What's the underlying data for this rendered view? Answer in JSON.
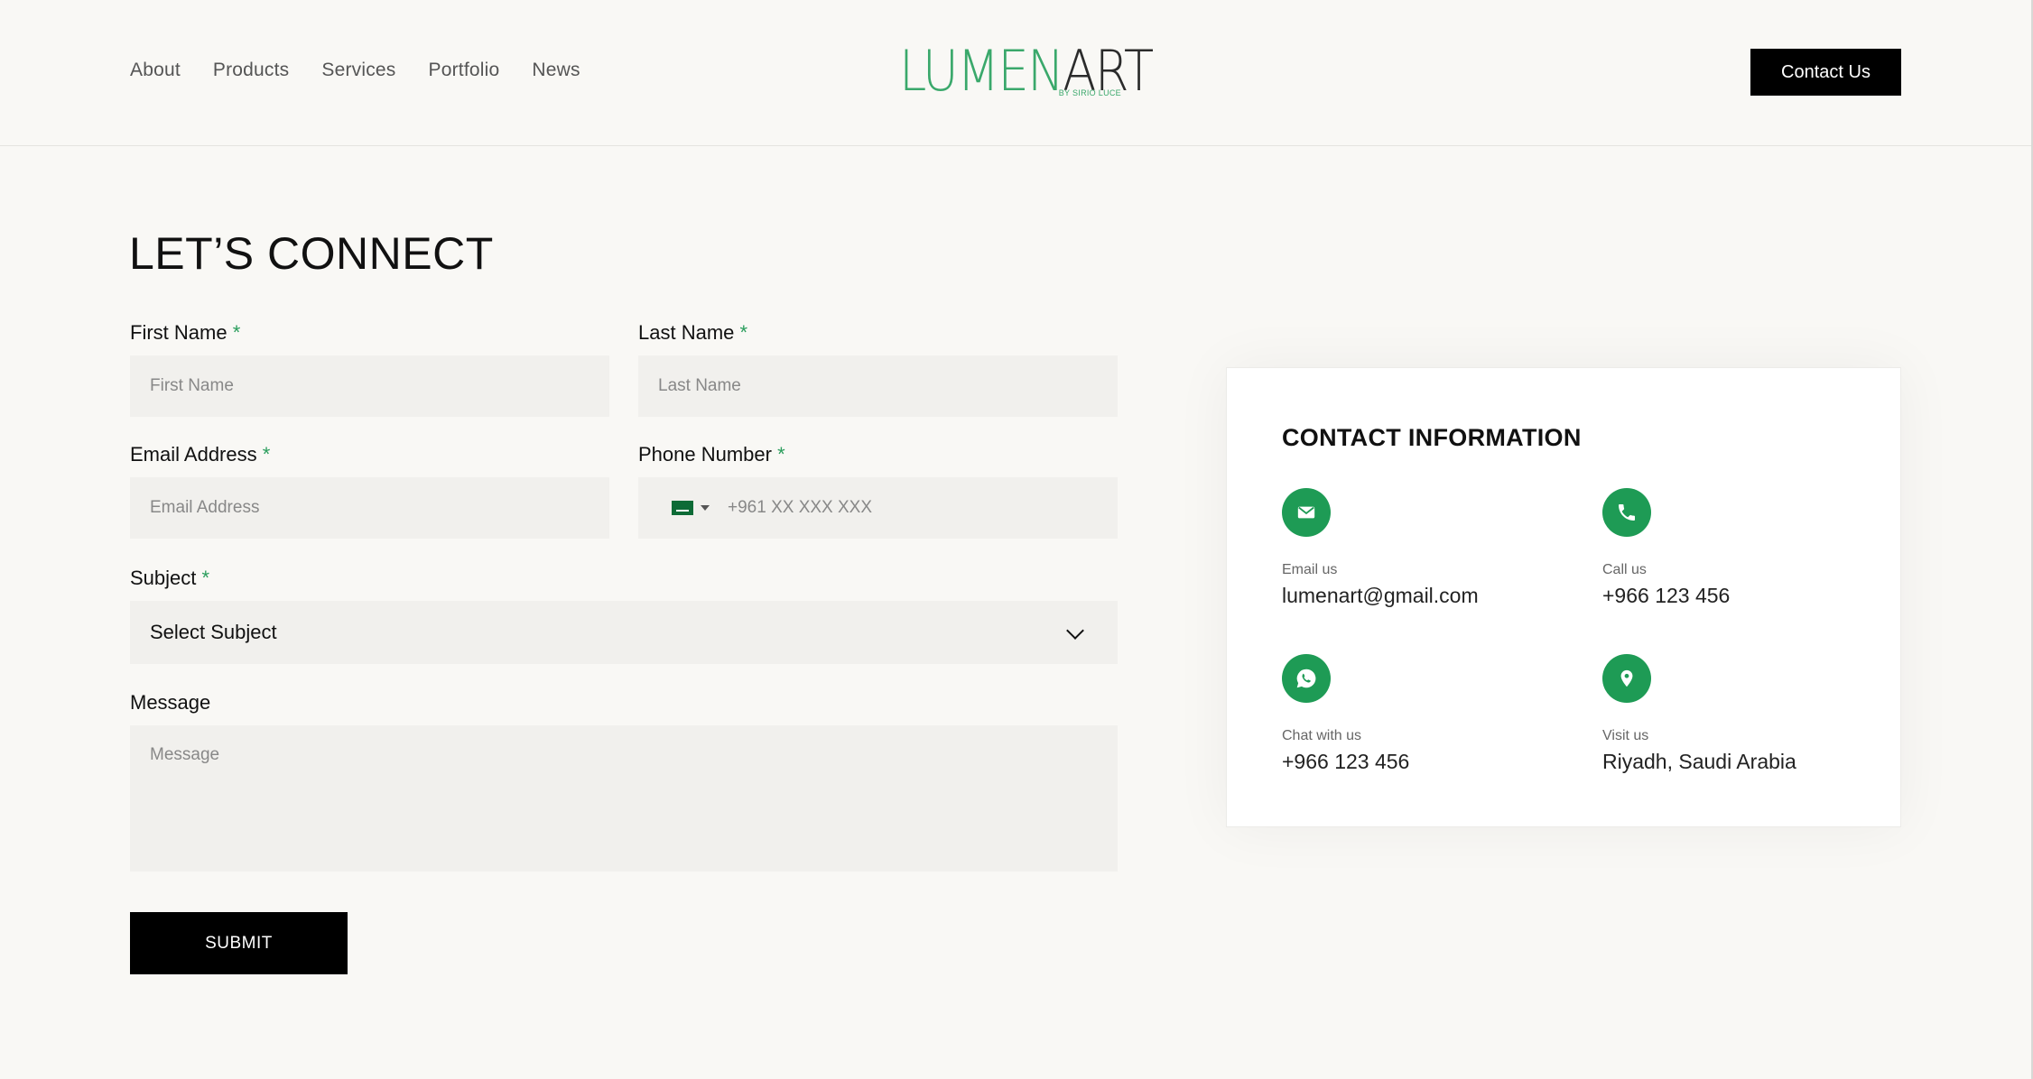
{
  "nav": {
    "items": [
      "About",
      "Products",
      "Services",
      "Portfolio",
      "News"
    ]
  },
  "logo": {
    "part1": "LUMEN",
    "part2": "ART",
    "sub": "BY SIRIO LUCE"
  },
  "header": {
    "contact_button": "Contact Us"
  },
  "form": {
    "title": "LET’S CONNECT",
    "first_name": {
      "label": "First Name",
      "required": "*",
      "placeholder": "First Name"
    },
    "last_name": {
      "label": "Last Name",
      "required": "*",
      "placeholder": "Last Name"
    },
    "email": {
      "label": "Email Address",
      "required": "*",
      "placeholder": "Email Address"
    },
    "phone": {
      "label": "Phone Number",
      "required": "*",
      "placeholder": "+961 XX XXX XXX"
    },
    "subject": {
      "label": "Subject",
      "required": "*",
      "value": "Select Subject"
    },
    "message": {
      "label": "Message",
      "placeholder": "Message"
    },
    "submit": "SUBMIT"
  },
  "contact_info": {
    "title": "CONTACT INFORMATION",
    "items": [
      {
        "icon": "email-icon",
        "label": "Email us",
        "value": "lumenart@gmail.com"
      },
      {
        "icon": "phone-icon",
        "label": "Call us",
        "value": "+966 123 456"
      },
      {
        "icon": "whatsapp-icon",
        "label": "Chat with us",
        "value": "+966 123 456"
      },
      {
        "icon": "location-pin-icon",
        "label": "Visit us",
        "value": "Riyadh, Saudi Arabia"
      }
    ]
  },
  "colors": {
    "accent_green": "#1e9b55",
    "background": "#f9f8f5",
    "input_bg": "#f1f0ed",
    "button_bg": "#000000"
  }
}
